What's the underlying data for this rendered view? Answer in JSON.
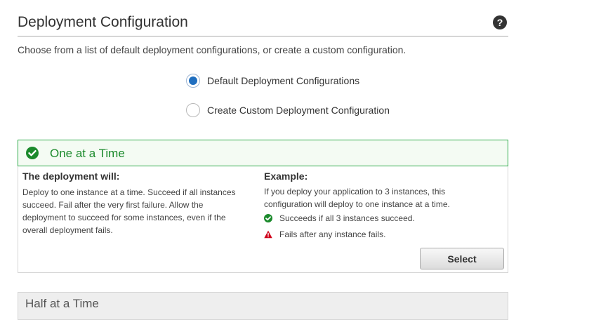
{
  "header": {
    "title": "Deployment Configuration",
    "help_icon": "question-circle-icon"
  },
  "intro": "Choose from a list of default deployment configurations, or create a custom configuration.",
  "radios": [
    {
      "label": "Default Deployment Configurations",
      "checked": true
    },
    {
      "label": "Create Custom Deployment Configuration",
      "checked": false
    }
  ],
  "card": {
    "title": "One at a Time",
    "title_icon": "check-circle-icon",
    "deployment_heading": "The deployment will:",
    "deployment_text": "Deploy to one instance at a time. Succeed if all instances succeed. Fail after the very first failure. Allow the deployment to succeed for some instances, even if the overall deployment fails.",
    "example_heading": "Example:",
    "example_text": "If you deploy your application to 3 instances, this configuration will deploy to one instance at a time.",
    "success_bullet": "Succeeds if all 3 instances succeed.",
    "fail_bullet": "Fails after any instance fails.",
    "select_label": "Select"
  },
  "next_card": {
    "title": "Half at a Time"
  },
  "colors": {
    "accent": "#1f6ebf",
    "success": "#1b8a2c",
    "warning": "#d0021b"
  }
}
